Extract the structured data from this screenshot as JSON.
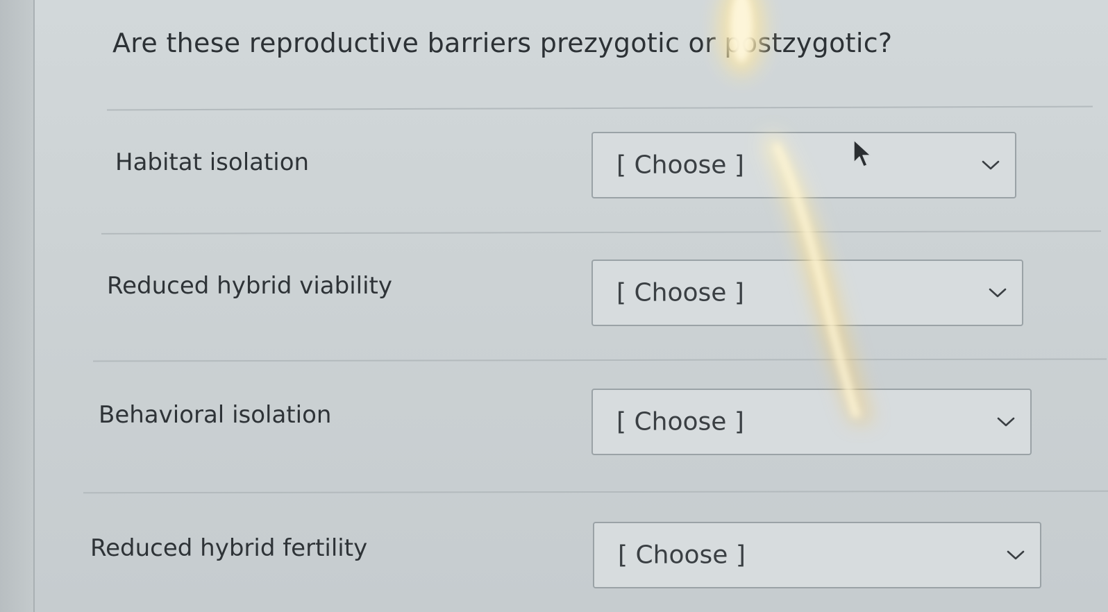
{
  "question": {
    "text": "Are these reproductive barriers prezygotic or postzygotic?"
  },
  "rows": [
    {
      "label": "Habitat isolation",
      "select": {
        "value": "[ Choose ]"
      }
    },
    {
      "label": "Reduced hybrid viability",
      "select": {
        "value": "[ Choose ]"
      }
    },
    {
      "label": "Behavioral isolation",
      "select": {
        "value": "[ Choose ]"
      }
    },
    {
      "label": "Reduced hybrid fertility",
      "select": {
        "value": "[ Choose ]"
      }
    }
  ],
  "icons": {
    "dropdown": "chevron-down-icon",
    "pointer": "mouse-pointer-icon"
  },
  "colors": {
    "text": "#2c3135",
    "select_border": "#9aa2a6",
    "background": "#ccd2d4"
  }
}
